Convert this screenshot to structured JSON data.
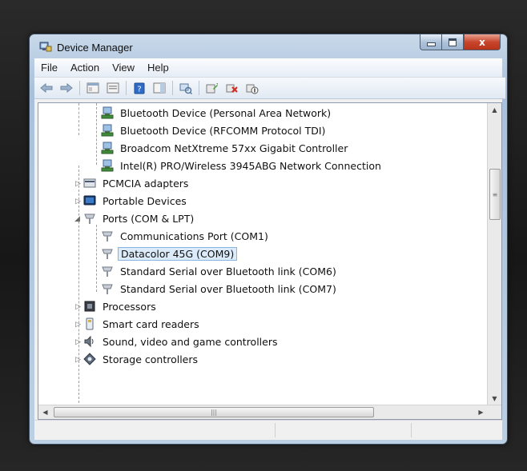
{
  "window": {
    "title": "Device Manager",
    "close_glyph": "x",
    "accent_color": "#c8462d",
    "selection_color": "#dcebfa"
  },
  "menu": [
    "File",
    "Action",
    "View",
    "Help"
  ],
  "toolbar": {
    "buttons": [
      "back-arrow-icon",
      "forward-arrow-icon",
      "show-hide-console-tree-icon",
      "properties-icon",
      "help-icon",
      "action-pane-icon",
      "scan-hardware-changes-icon",
      "update-driver-icon",
      "uninstall-icon",
      "disable-device-icon"
    ]
  },
  "tree": [
    {
      "label": "Bluetooth Device (Personal Area Network)",
      "icon": "network-adapter-icon"
    },
    {
      "label": "Bluetooth Device (RFCOMM Protocol TDI)",
      "icon": "network-adapter-icon"
    },
    {
      "label": "Broadcom NetXtreme 57xx Gigabit Controller",
      "icon": "network-adapter-icon"
    },
    {
      "label": "Intel(R) PRO/Wireless 3945ABG Network Connection",
      "icon": "network-adapter-icon"
    },
    {
      "label": "PCMCIA adapters",
      "icon": "pcmcia-icon"
    },
    {
      "label": "Portable Devices",
      "icon": "portable-device-icon"
    },
    {
      "label": "Ports (COM & LPT)",
      "icon": "port-icon"
    },
    {
      "label": "Communications Port (COM1)",
      "icon": "port-icon"
    },
    {
      "label": "Datacolor 45G (COM9)",
      "icon": "port-icon",
      "selected": true
    },
    {
      "label": "Standard Serial over Bluetooth link (COM6)",
      "icon": "port-icon"
    },
    {
      "label": "Standard Serial over Bluetooth link (COM7)",
      "icon": "port-icon"
    },
    {
      "label": "Processors",
      "icon": "processor-icon"
    },
    {
      "label": "Smart card readers",
      "icon": "smart-card-icon"
    },
    {
      "label": "Sound, video and game controllers",
      "icon": "sound-icon"
    },
    {
      "label": "Storage controllers",
      "icon": "storage-icon"
    }
  ]
}
